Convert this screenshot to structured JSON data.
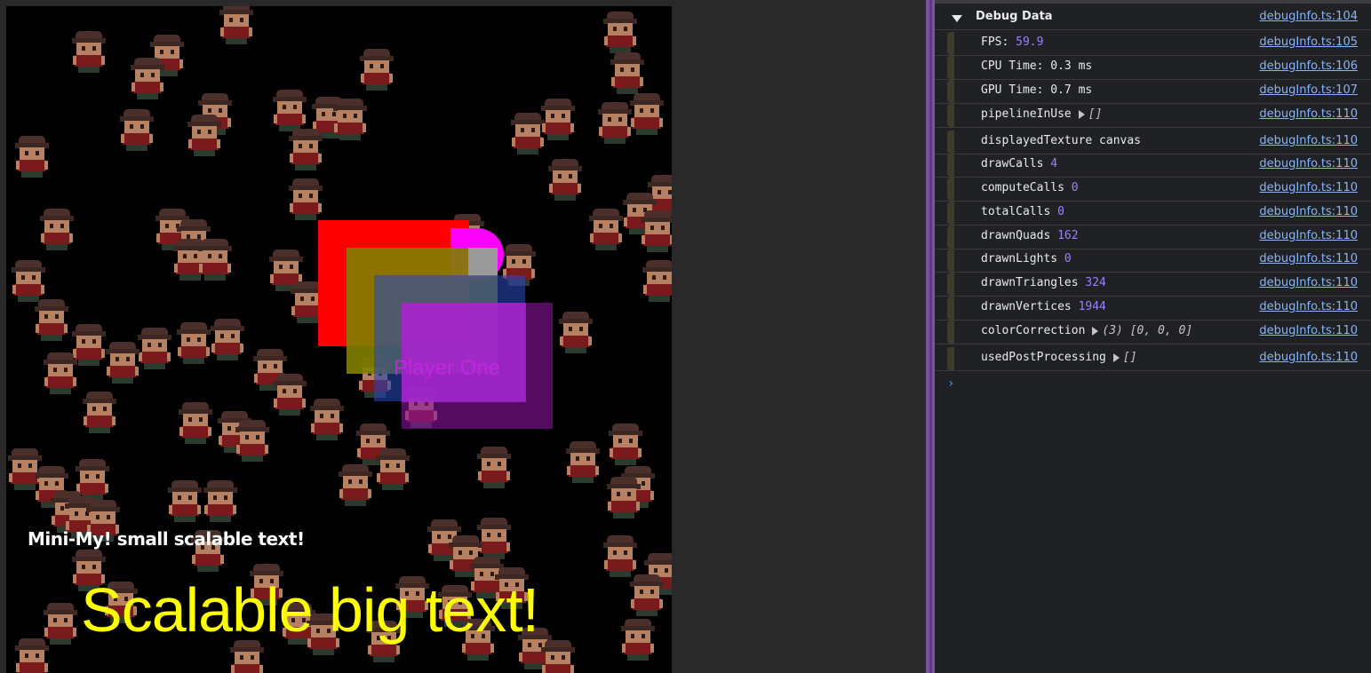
{
  "canvas": {
    "player_label": "Player One",
    "mini_text": "Mini-My! small scalable text!",
    "big_text": "Scalable big text!",
    "colors": {
      "background": "#000000",
      "mini_text": "#ffffff",
      "big_text": "#ffff00",
      "rect_red": "#ff0000",
      "rect_magenta": "#ff00ff",
      "rect_olive": "#808000",
      "rect_blue": "#2846b4",
      "rect_purple": "#8c14a0"
    }
  },
  "console": {
    "group": {
      "title": "Debug Data",
      "source": "debugInfo.ts:104",
      "expanded": true
    },
    "rows": [
      {
        "key": "FPS: ",
        "value": "59.9",
        "value_color": "num",
        "source": "debugInfo.ts:105"
      },
      {
        "key": "CPU Time: 0.3 ms",
        "value": "",
        "value_color": "",
        "source": "debugInfo.ts:106"
      },
      {
        "key": "GPU Time: 0.7 ms",
        "value": "",
        "value_color": "",
        "source": "debugInfo.ts:107"
      },
      {
        "key": "pipelineInUse",
        "value": "[]",
        "value_color": "arr",
        "expandable": true,
        "source": "debugInfo.ts:110"
      },
      {
        "key": "displayedTexture canvas",
        "value": "",
        "value_color": "",
        "source": "debugInfo.ts:110"
      },
      {
        "key": "drawCalls ",
        "value": "4",
        "value_color": "num",
        "source": "debugInfo.ts:110"
      },
      {
        "key": "computeCalls ",
        "value": "0",
        "value_color": "num",
        "source": "debugInfo.ts:110"
      },
      {
        "key": "totalCalls ",
        "value": "0",
        "value_color": "num",
        "source": "debugInfo.ts:110"
      },
      {
        "key": "drawnQuads ",
        "value": "162",
        "value_color": "num",
        "source": "debugInfo.ts:110"
      },
      {
        "key": "drawnLights ",
        "value": "0",
        "value_color": "num",
        "source": "debugInfo.ts:110"
      },
      {
        "key": "drawnTriangles ",
        "value": "324",
        "value_color": "num",
        "source": "debugInfo.ts:110"
      },
      {
        "key": "drawnVertices ",
        "value": "1944",
        "value_color": "num",
        "source": "debugInfo.ts:110"
      },
      {
        "key": "colorCorrection",
        "value": "(3) [0, 0, 0]",
        "value_color": "arr",
        "expandable": true,
        "source": "debugInfo.ts:110"
      },
      {
        "key": "usedPostProcessing",
        "value": "[]",
        "value_color": "arr",
        "expandable": true,
        "source": "debugInfo.ts:110"
      }
    ],
    "prompt_glyph": "›",
    "colors": {
      "background": "#202124",
      "text": "#e8eaed",
      "number": "#9980ff",
      "link": "#8ab4f8",
      "divider": "#7a52a0"
    }
  }
}
